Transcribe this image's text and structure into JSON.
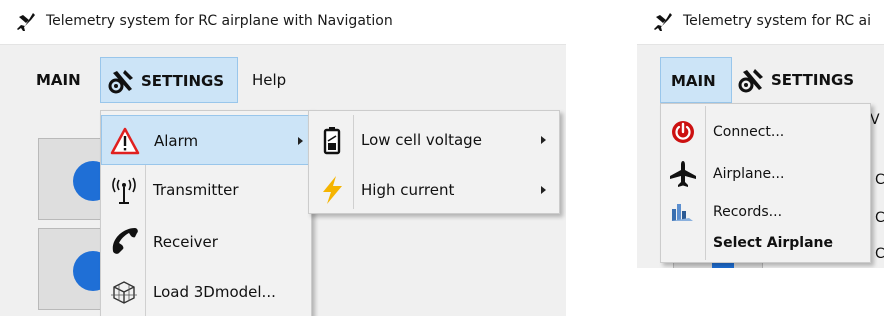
{
  "left_window": {
    "title": "Telemetry system for RC airplane with Navigation",
    "menubar": {
      "main": "MAIN",
      "settings": "SETTINGS",
      "help": "Help"
    },
    "settings_menu": {
      "items": [
        {
          "label": "Alarm",
          "icon": "warning-triangle-icon"
        },
        {
          "label": "Transmitter",
          "icon": "antenna-icon"
        },
        {
          "label": "Receiver",
          "icon": "phone-icon"
        },
        {
          "label": "Load 3Dmodel...",
          "icon": "3d-model-icon"
        }
      ]
    },
    "alarm_submenu": {
      "items": [
        {
          "label": "Low cell voltage",
          "icon": "battery-icon"
        },
        {
          "label": "High current",
          "icon": "lightning-icon"
        }
      ]
    }
  },
  "right_window": {
    "title": "Telemetry system for RC ai",
    "menubar": {
      "main": "MAIN",
      "settings": "SETTINGS"
    },
    "main_menu": {
      "items": [
        {
          "label": "Connect...",
          "icon": "power-icon"
        },
        {
          "label": "Airplane...",
          "icon": "airplane-icon"
        },
        {
          "label": "Records...",
          "icon": "records-icon"
        },
        {
          "label": "Select Airplane",
          "icon": ""
        }
      ]
    },
    "background_text": {
      "w": "V",
      "c1": "C",
      "c2": "C",
      "c3": "C"
    }
  },
  "colors": {
    "highlight": "#cce4f7",
    "highlight_border": "#99c6eb",
    "accent_blue": "#1f6fd6",
    "warning_red": "#e02020",
    "lightning_yellow": "#f5b400",
    "power_red": "#cc1111"
  }
}
